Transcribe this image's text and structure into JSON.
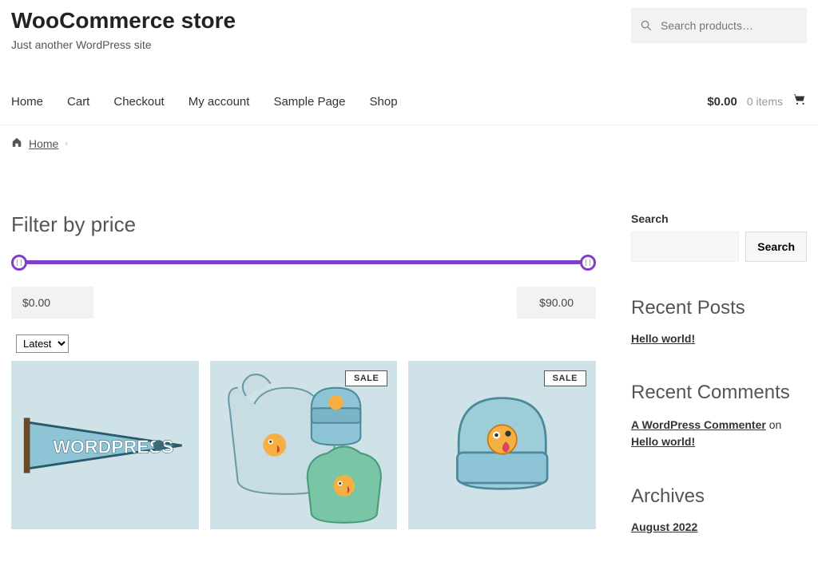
{
  "header": {
    "site_title": "WooCommerce store",
    "tagline": "Just another WordPress site",
    "search_placeholder": "Search products…"
  },
  "nav": {
    "items": [
      "Home",
      "Cart",
      "Checkout",
      "My account",
      "Sample Page",
      "Shop"
    ],
    "cart_total": "$0.00",
    "cart_items": "0 items"
  },
  "breadcrumb": {
    "home": "Home"
  },
  "filter": {
    "title": "Filter by price",
    "min": "$0.00",
    "max": "$90.00"
  },
  "sort": {
    "selected": "Latest"
  },
  "products": [
    {
      "badge": null
    },
    {
      "badge": "SALE"
    },
    {
      "badge": "SALE"
    }
  ],
  "sidebar": {
    "search_label": "Search",
    "search_button": "Search",
    "recent_posts_title": "Recent Posts",
    "recent_posts": [
      "Hello world!"
    ],
    "recent_comments_title": "Recent Comments",
    "recent_comment_author": "A WordPress Commenter",
    "recent_comment_on": " on ",
    "recent_comment_post": "Hello world!",
    "archives_title": "Archives",
    "archives": [
      "August 2022"
    ]
  }
}
